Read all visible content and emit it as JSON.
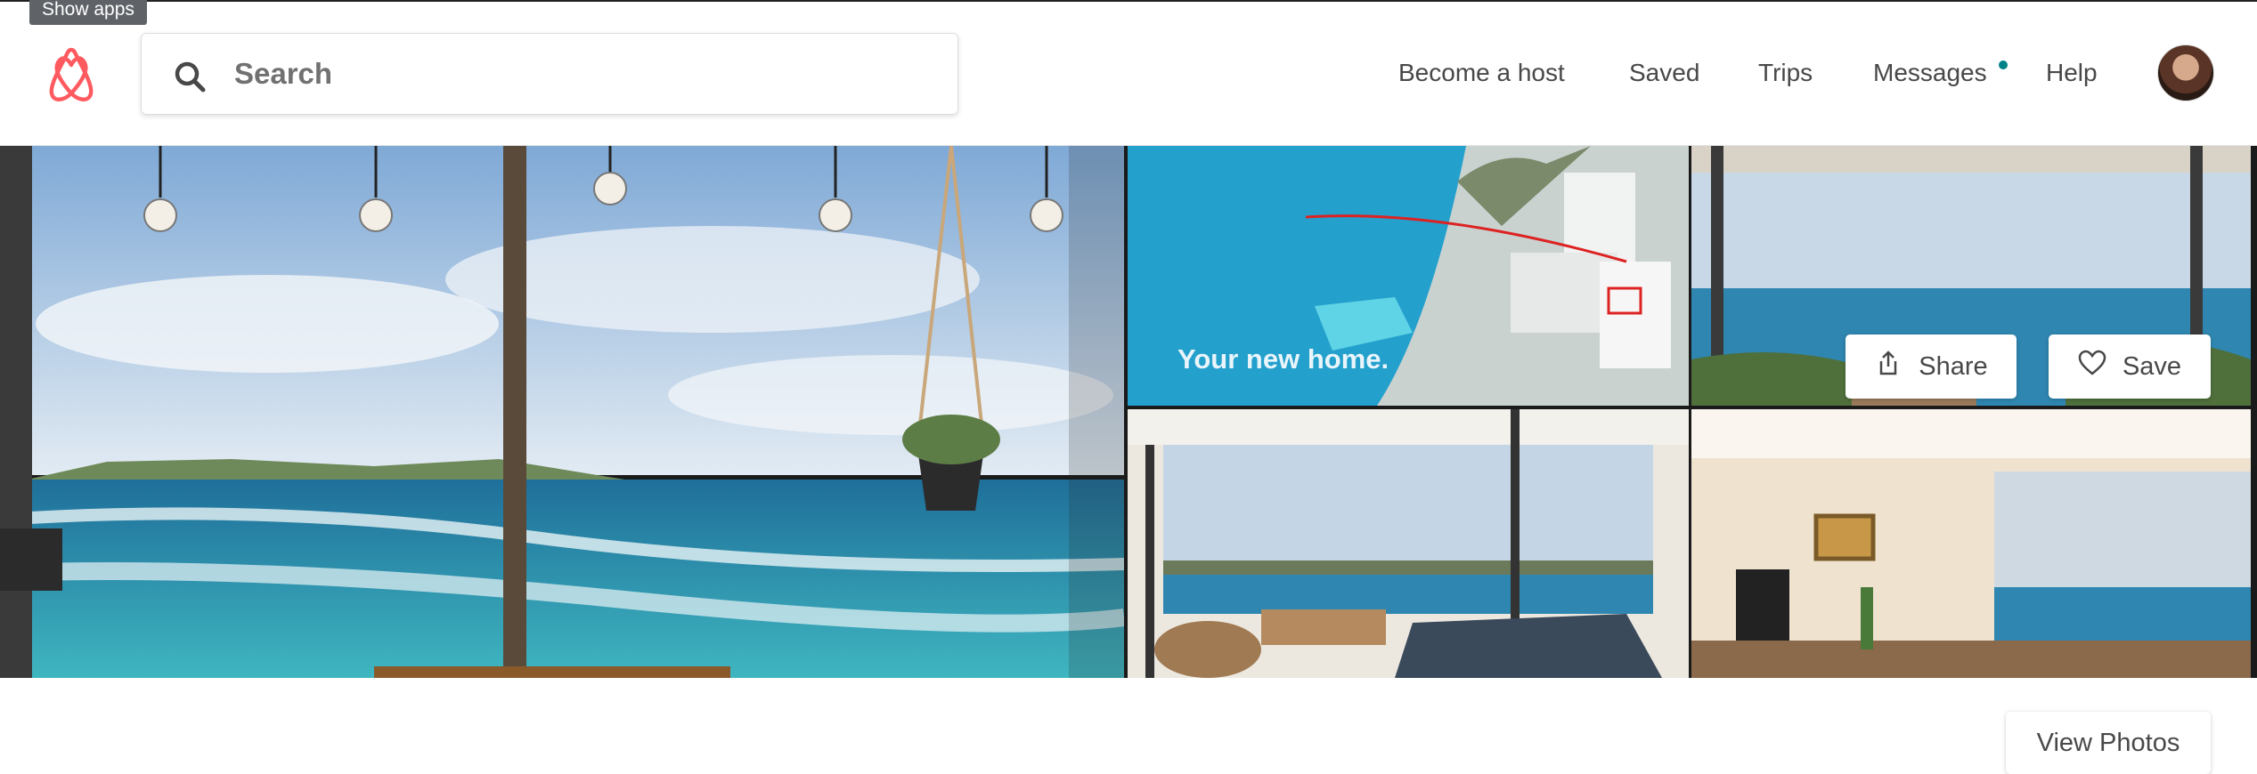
{
  "tooltip": {
    "text": "Show apps"
  },
  "header": {
    "search_placeholder": "Search",
    "nav": {
      "become_host": "Become a host",
      "saved": "Saved",
      "trips": "Trips",
      "messages": "Messages",
      "help": "Help"
    },
    "messages_unread_dot_color": "#008489",
    "brand_color": "#FF5A5F"
  },
  "gallery": {
    "aerial_caption": "Your new home.",
    "share_label": "Share",
    "save_label": "Save",
    "view_photos_label": "View Photos",
    "photos": [
      "main-balcony-ocean-view",
      "aerial-bondi-building",
      "balcony-plants-view",
      "living-room-ocean-view",
      "room-tv-ocean-view"
    ]
  }
}
